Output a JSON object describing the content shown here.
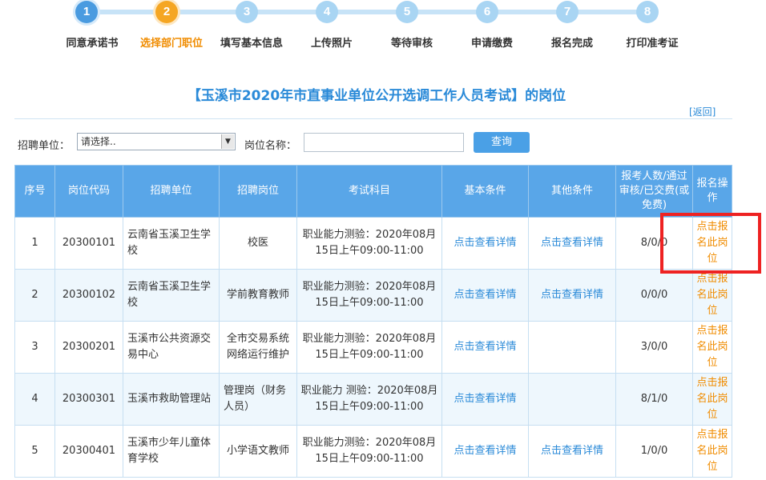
{
  "steps": [
    {
      "num": "1",
      "label": "同意承诺书",
      "state": "done"
    },
    {
      "num": "2",
      "label": "选择部门职位",
      "state": "active"
    },
    {
      "num": "3",
      "label": "填写基本信息",
      "state": "todo"
    },
    {
      "num": "4",
      "label": "上传照片",
      "state": "todo"
    },
    {
      "num": "5",
      "label": "等待审核",
      "state": "todo"
    },
    {
      "num": "6",
      "label": "申请缴费",
      "state": "todo"
    },
    {
      "num": "7",
      "label": "报名完成",
      "state": "todo"
    },
    {
      "num": "8",
      "label": "打印准考证",
      "state": "todo"
    }
  ],
  "page": {
    "title": "【玉溪市2020年市直事业单位公开选调工作人员考试】的岗位",
    "back": "[返回]"
  },
  "filter": {
    "unit_label": "招聘单位：",
    "unit_value": "请选择..",
    "position_label": "岗位名称：",
    "position_value": "",
    "query_button": "查询"
  },
  "table": {
    "headers": {
      "no": "序号",
      "code": "岗位代码",
      "unit": "招聘单位",
      "post": "招聘岗位",
      "subject": "考试科目",
      "basic": "基本条件",
      "other": "其他条件",
      "count": "报考人数/通过审核/已交费(或免费)",
      "action": "报名操作"
    },
    "rows": [
      {
        "no": "1",
        "code": "20300101",
        "unit": "云南省玉溪卫生学校",
        "post": "校医",
        "subject": "职业能力测验：2020年08月15日上午09:00-11:00",
        "basic": "点击查看详情",
        "other": "点击查看详情",
        "count": "8/0/0",
        "action": "点击报名此岗位"
      },
      {
        "no": "2",
        "code": "20300102",
        "unit": "云南省玉溪卫生学校",
        "post": "学前教育教师",
        "subject": "职业能力测验：2020年08月15日上午09:00-11:00",
        "basic": "点击查看详情",
        "other": "点击查看详情",
        "count": "0/0/0",
        "action": "点击报名此岗位"
      },
      {
        "no": "3",
        "code": "20300201",
        "unit": "玉溪市公共资源交易中心",
        "post": "全市交易系统网络运行维护",
        "subject": "职业能力测验：2020年08月15日上午09:00-11:00",
        "basic": "点击查看详情",
        "other": "",
        "count": "3/0/0",
        "action": "点击报名此岗位"
      },
      {
        "no": "4",
        "code": "20300301",
        "unit": "玉溪市救助管理站",
        "post": "管理岗（财务人员）",
        "subject": "职业能力 测验：2020年08月15日上午09:00-11:00",
        "basic": "点击查看详情",
        "other": "",
        "count": "8/1/0",
        "action": "点击报名此岗位"
      },
      {
        "no": "5",
        "code": "20300401",
        "unit": "玉溪市少年儿童体育学校",
        "post": "小学语文教师",
        "subject": "职业能力测验：2020年08月15日上午09:00-11:00",
        "basic": "点击查看详情",
        "other": "点击查看详情",
        "count": "1/0/0",
        "action": "点击报名此岗位"
      }
    ]
  },
  "colors": {
    "accent_blue": "#2a8ad8",
    "header_blue": "#59a6e8",
    "active_orange": "#f08c00",
    "highlight_red": "#ee2222"
  }
}
